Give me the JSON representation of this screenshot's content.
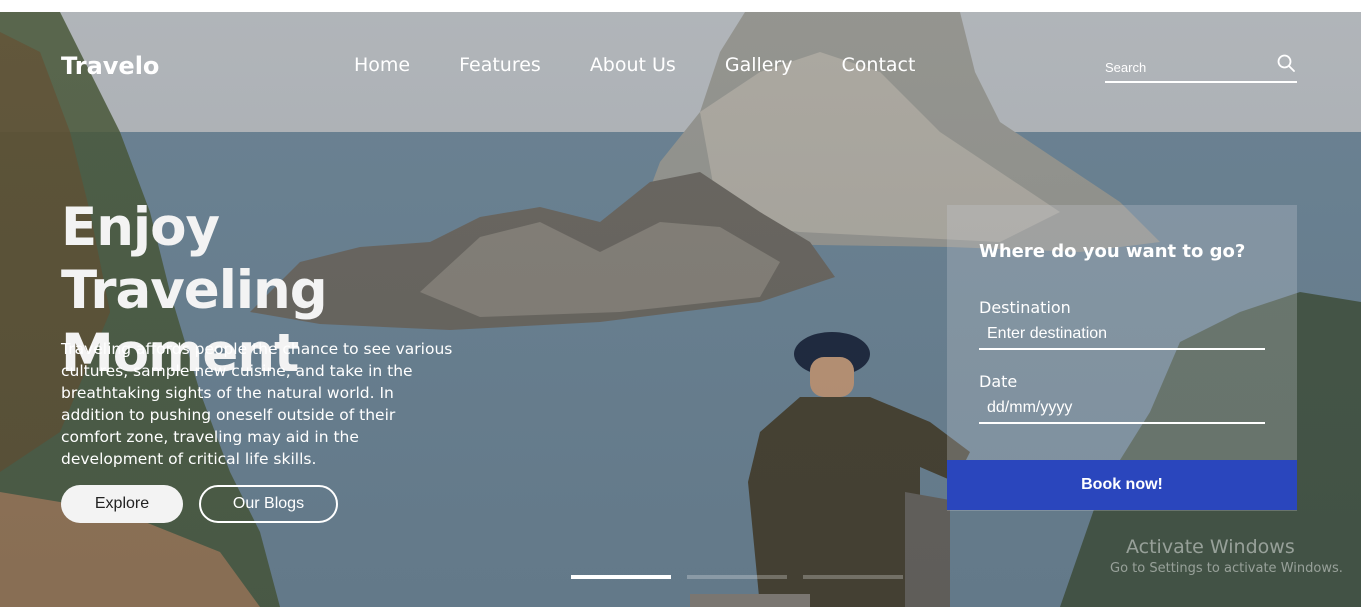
{
  "brand": {
    "name": "Travelo"
  },
  "nav": {
    "items": [
      {
        "label": "Home"
      },
      {
        "label": "Features"
      },
      {
        "label": "About Us"
      },
      {
        "label": "Gallery"
      },
      {
        "label": "Contact"
      }
    ]
  },
  "search": {
    "placeholder": "Search",
    "icon": "search-icon"
  },
  "hero": {
    "headline_line1": "Enjoy Traveling",
    "headline_line2": "Moment",
    "description": "Traveling affords people the chance to see various cultures, sample new cuisine, and take in the breathtaking sights of the natural world. In addition to pushing oneself outside of their comfort zone, traveling may aid in the development of critical life skills.",
    "explore_label": "Explore",
    "blogs_label": "Our Blogs"
  },
  "booking": {
    "title": "Where do you want to go?",
    "destination_label": "Destination",
    "destination_placeholder": "Enter destination",
    "date_label": "Date",
    "date_placeholder": "dd/mm/yyyy",
    "submit_label": "Book now!",
    "accent_color": "#2a46bd"
  },
  "slider": {
    "slide_count": 3,
    "active_index": 0
  },
  "watermark": {
    "title": "Activate Windows",
    "subtitle": "Go to Settings to activate Windows."
  }
}
